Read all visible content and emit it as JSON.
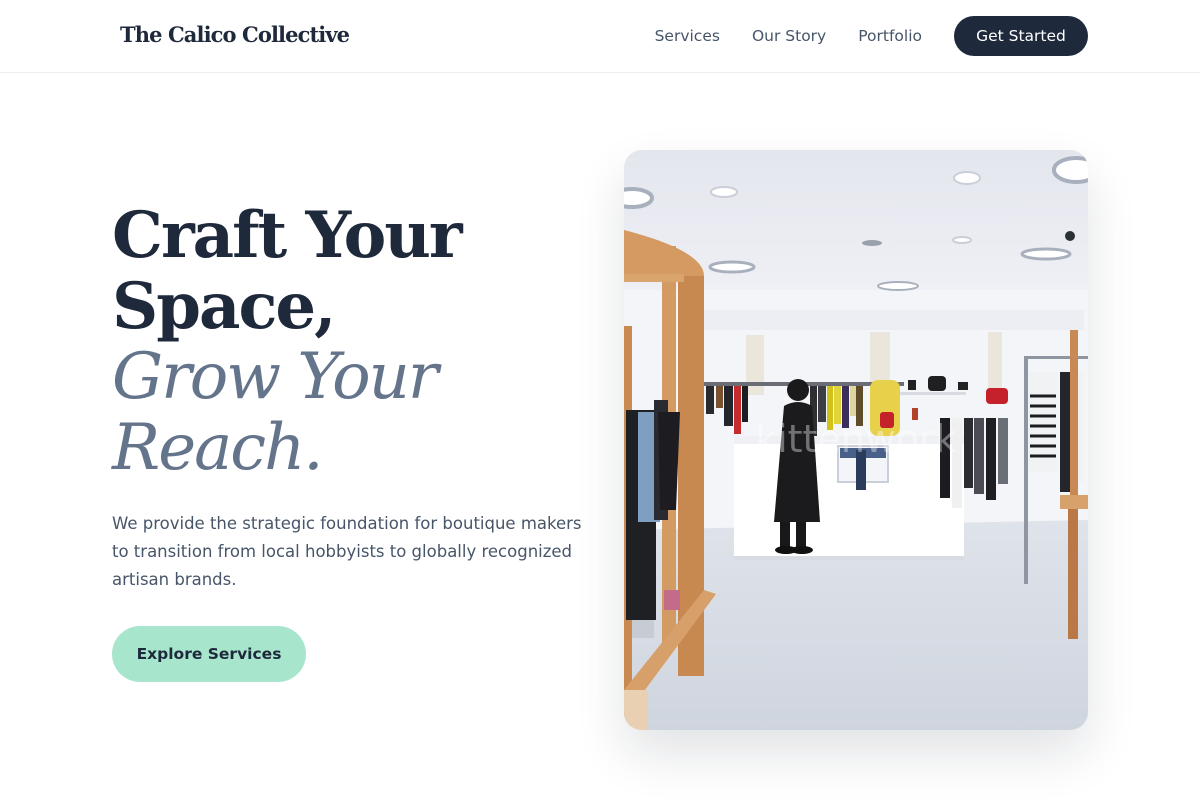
{
  "nav": {
    "brand": "The Calico Collective",
    "links": [
      "Services",
      "Our Story",
      "Portfolio"
    ],
    "cta": "Get Started"
  },
  "hero": {
    "title_lines": [
      "Craft Your",
      "Space,"
    ],
    "accent_lines": [
      "Grow Your",
      "Reach."
    ],
    "description": "We provide the strategic foundation for boutique makers to transition from local hobbyists to globally recognized artisan brands.",
    "button": "Explore Services",
    "image_watermark": "kittenwork"
  },
  "colors": {
    "primary": "#1e293b",
    "accent_text": "#64748b",
    "body_text": "#475569",
    "button_mint": "#a7e6cd"
  }
}
